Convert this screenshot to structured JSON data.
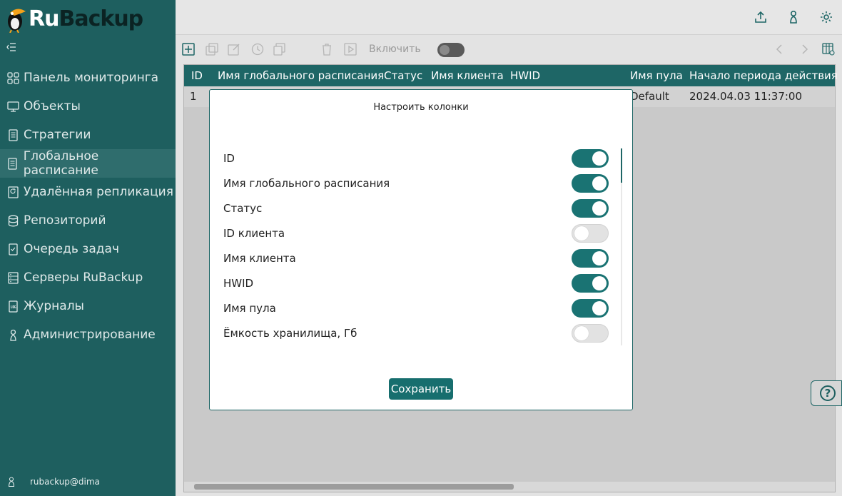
{
  "app": {
    "logo_ru": "Ru",
    "logo_backup": "Backup",
    "user": "rubackup@dima"
  },
  "sidebar": {
    "items": [
      {
        "label": "Панель мониторинга",
        "icon": "dashboard-icon"
      },
      {
        "label": "Объекты",
        "icon": "monitor-icon"
      },
      {
        "label": "Стратегии",
        "icon": "document-icon"
      },
      {
        "label": "Глобальное расписание",
        "icon": "schedule-icon",
        "active": true
      },
      {
        "label": "Удалённая репликация",
        "icon": "replication-icon"
      },
      {
        "label": "Репозиторий",
        "icon": "database-icon"
      },
      {
        "label": "Очередь задач",
        "icon": "checklist-icon"
      },
      {
        "label": "Серверы RuBackup",
        "icon": "server-icon"
      },
      {
        "label": "Журналы",
        "icon": "log-icon"
      },
      {
        "label": "Администрирование",
        "icon": "admin-icon"
      }
    ]
  },
  "toolbar": {
    "enable_label": "Включить"
  },
  "table": {
    "headers": [
      "ID",
      "Имя глобального расписания",
      "Статус",
      "Имя клиента",
      "HWID",
      "Имя пула",
      "Начало периода действия"
    ],
    "row": {
      "id": "1",
      "pool": "Default",
      "start": "2024.04.03 11:37:00"
    }
  },
  "modal": {
    "title": "Настроить колонки",
    "columns": [
      {
        "label": "ID",
        "on": true
      },
      {
        "label": "Имя глобального расписания",
        "on": true
      },
      {
        "label": "Статус",
        "on": true
      },
      {
        "label": "ID клиента",
        "on": false
      },
      {
        "label": "Имя клиента",
        "on": true
      },
      {
        "label": "HWID",
        "on": true
      },
      {
        "label": "Имя пула",
        "on": true
      },
      {
        "label": "Ёмкость хранилища, Гб",
        "on": false
      }
    ],
    "save_label": "Сохранить"
  },
  "help": {
    "label": "?"
  },
  "colors": {
    "accent": "#1a7373",
    "sidebar": "#1e5f5f",
    "table_header": "#1e6666"
  }
}
